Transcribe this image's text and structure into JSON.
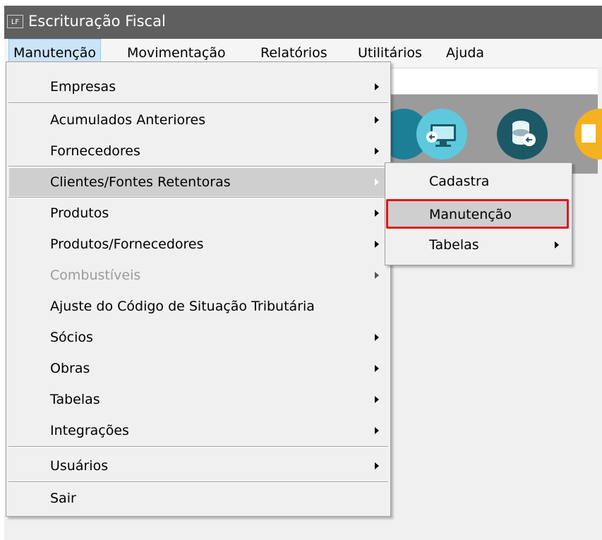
{
  "window": {
    "app_icon_text": "LF",
    "title": "Escrituração Fiscal"
  },
  "menubar": {
    "items": [
      {
        "label": "Manutenção",
        "active": true
      },
      {
        "label": "Movimentação"
      },
      {
        "label": "Relatórios"
      },
      {
        "label": "Utilitários"
      },
      {
        "label": "Ajuda"
      }
    ]
  },
  "toolbar": {
    "icons": [
      "database-icon",
      "monitor-back-icon",
      "database-back-icon",
      "document-icon"
    ]
  },
  "menu": {
    "items": [
      {
        "label": "Empresas",
        "submenu": true
      },
      {
        "label": "Acumulados Anteriores",
        "submenu": true
      },
      {
        "label": "Fornecedores",
        "submenu": true
      },
      {
        "label": "Clientes/Fontes Retentoras",
        "submenu": true,
        "hover": true
      },
      {
        "label": "Produtos",
        "submenu": true
      },
      {
        "label": "Produtos/Fornecedores",
        "submenu": true
      },
      {
        "label": "Combustíveis",
        "submenu": true,
        "disabled": true
      },
      {
        "label": "Ajuste do Código de Situação Tributária",
        "submenu": false
      },
      {
        "label": "Sócios",
        "submenu": true
      },
      {
        "label": "Obras",
        "submenu": true
      },
      {
        "label": "Tabelas",
        "submenu": true
      },
      {
        "label": "Integrações",
        "submenu": true
      },
      {
        "label": "Usuários",
        "submenu": true
      },
      {
        "label": "Sair",
        "submenu": false
      }
    ]
  },
  "submenu": {
    "items": [
      {
        "label": "Cadastra",
        "submenu": false
      },
      {
        "label": "Manutenção",
        "submenu": false,
        "hover": true
      },
      {
        "label": "Tabelas",
        "submenu": true
      }
    ]
  },
  "colors": {
    "titlebar": "#5f5f5f",
    "menu_bg": "#f0f0f0",
    "hover": "#cfcfcf",
    "annotation_red": "#e3141b"
  }
}
